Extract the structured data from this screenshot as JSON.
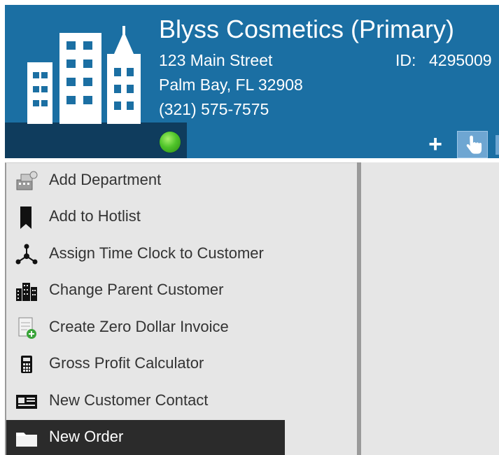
{
  "header": {
    "company_name": "Blyss Cosmetics (Primary)",
    "address_line1": "123 Main Street",
    "address_line2": "Palm Bay, FL   32908",
    "phone": "(321) 575-7575",
    "id_label": "ID:",
    "id_value": "4295009",
    "status_color": "#4fc42a",
    "header_bg": "#1b6fa3",
    "logo_icon": "buildings-icon"
  },
  "toolbar": {
    "add_icon": "plus-icon",
    "select_icon": "hand-pointer-icon"
  },
  "menu": {
    "items": [
      {
        "label": "Add Department",
        "icon": "department-icon"
      },
      {
        "label": "Add to Hotlist",
        "icon": "bookmark-icon"
      },
      {
        "label": "Assign Time Clock to Customer",
        "icon": "network-icon"
      },
      {
        "label": "Change Parent Customer",
        "icon": "buildings-icon"
      },
      {
        "label": "Create Zero Dollar Invoice",
        "icon": "invoice-add-icon"
      },
      {
        "label": "Gross Profit Calculator",
        "icon": "calculator-icon"
      },
      {
        "label": "New Customer Contact",
        "icon": "contact-card-icon"
      },
      {
        "label": "New Order",
        "icon": "folder-icon",
        "selected": true
      }
    ]
  }
}
